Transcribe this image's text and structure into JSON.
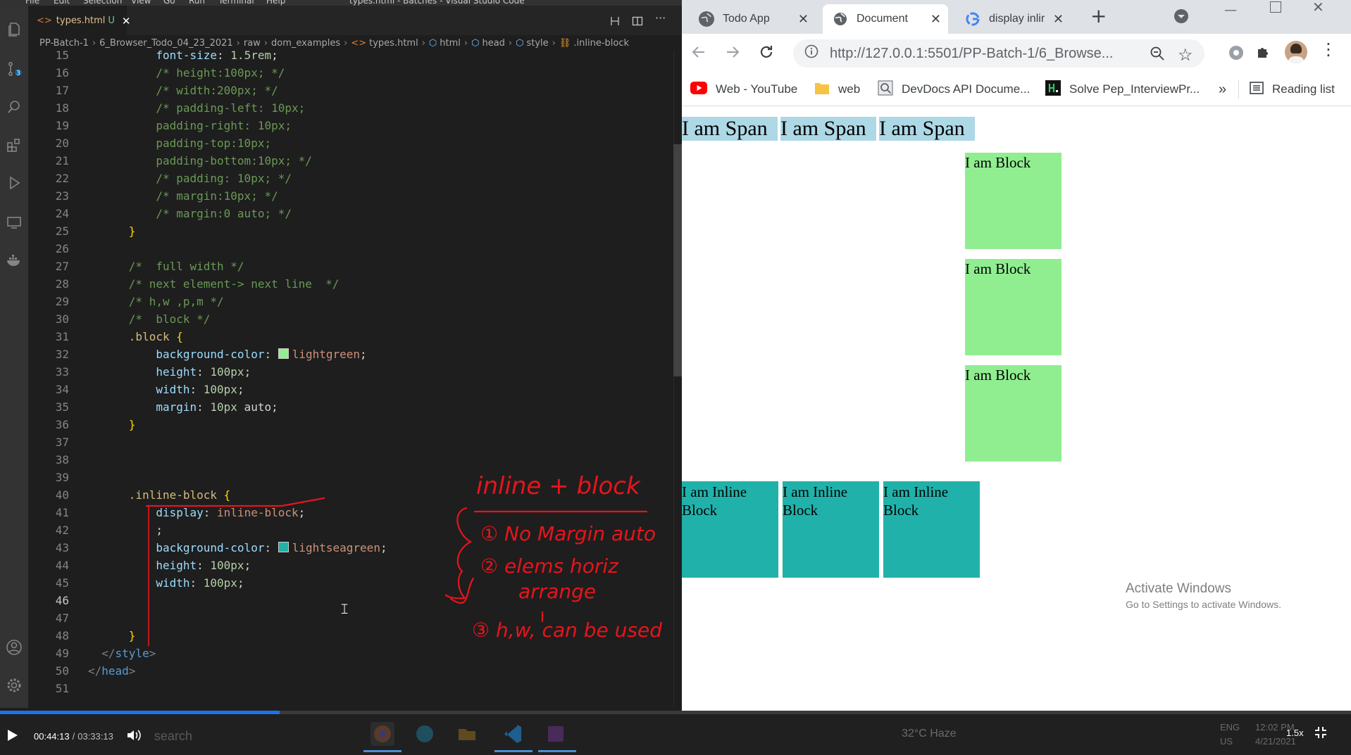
{
  "vscode": {
    "menu": [
      "File",
      "Edit",
      "Selection",
      "View",
      "Go",
      "Run",
      "Terminal",
      "Help"
    ],
    "window_title": "types.html - Batches - Visual Studio Code",
    "tab": {
      "filename": "types.html",
      "status": "U"
    },
    "breadcrumb": [
      "PP-Batch-1",
      "6_Browser_Todo_04_23_2021",
      "raw",
      "dom_examples",
      "types.html",
      "html",
      "head",
      "style",
      ".inline-block"
    ],
    "lines": [
      {
        "n": "15",
        "t": "          font-size: 1.5rem;"
      },
      {
        "n": "16",
        "t": "          /* height:100px; */"
      },
      {
        "n": "17",
        "t": "          /* width:200px; */"
      },
      {
        "n": "18",
        "t": "          /* padding-left: 10px;"
      },
      {
        "n": "19",
        "t": "          padding-right: 10px;"
      },
      {
        "n": "20",
        "t": "          padding-top:10px;"
      },
      {
        "n": "21",
        "t": "          padding-bottom:10px; */"
      },
      {
        "n": "22",
        "t": "          /* padding: 10px; */"
      },
      {
        "n": "23",
        "t": "          /* margin:10px; */"
      },
      {
        "n": "24",
        "t": "          /* margin:0 auto; */"
      },
      {
        "n": "25",
        "t": "      }"
      },
      {
        "n": "26",
        "t": ""
      },
      {
        "n": "27",
        "t": "      /*  full width */"
      },
      {
        "n": "28",
        "t": "      /* next element-> next line  */"
      },
      {
        "n": "29",
        "t": "      /* h,w ,p,m */"
      },
      {
        "n": "30",
        "t": "      /*  block */"
      },
      {
        "n": "31",
        "t": "      .block {"
      },
      {
        "n": "32",
        "t": "          background-color: lightgreen;"
      },
      {
        "n": "33",
        "t": "          height: 100px;"
      },
      {
        "n": "34",
        "t": "          width: 100px;"
      },
      {
        "n": "35",
        "t": "          margin: 10px auto;"
      },
      {
        "n": "36",
        "t": "      }"
      },
      {
        "n": "37",
        "t": ""
      },
      {
        "n": "38",
        "t": ""
      },
      {
        "n": "39",
        "t": ""
      },
      {
        "n": "40",
        "t": "      .inline-block {"
      },
      {
        "n": "41",
        "t": "          display: inline-block;"
      },
      {
        "n": "42",
        "t": "          ;"
      },
      {
        "n": "43",
        "t": "          background-color: lightseagreen;"
      },
      {
        "n": "44",
        "t": "          height: 100px;"
      },
      {
        "n": "45",
        "t": "          width: 100px;"
      },
      {
        "n": "46",
        "t": ""
      },
      {
        "n": "47",
        "t": ""
      },
      {
        "n": "48",
        "t": "      }"
      },
      {
        "n": "49",
        "t": "  </style>"
      },
      {
        "n": "50",
        "t": "</head>"
      },
      {
        "n": "51",
        "t": ""
      }
    ],
    "current_line": "46",
    "swatch_colors": {
      "lightgreen": "#90ee90",
      "lightseagreen": "#20b2aa"
    }
  },
  "annotation": {
    "title": "inline + block",
    "points": [
      "① No Margin auto",
      "② elems horiz",
      "arrange",
      "③ h,w, can be used"
    ],
    "color": "#e8141b"
  },
  "chrome": {
    "tabs": [
      {
        "title": "Todo App",
        "icon": "globe-icon",
        "active": false
      },
      {
        "title": "Document",
        "icon": "globe-icon",
        "active": true
      },
      {
        "title": "display inlir",
        "icon": "google-icon",
        "active": false
      }
    ],
    "url": "http://127.0.0.1:5501/PP-Batch-1/6_Browse...",
    "bookmarks": [
      {
        "label": "Web - YouTube",
        "icon": "youtube-icon"
      },
      {
        "label": "web",
        "icon": "folder-icon"
      },
      {
        "label": "DevDocs API Docume...",
        "icon": "devdocs-icon"
      },
      {
        "label": "Solve Pep_InterviewPr...",
        "icon": "hackerrank-icon"
      }
    ],
    "overflow": "»",
    "reading_list": "Reading list",
    "page": {
      "spans": [
        "I am Span",
        "I am Span",
        "I am Span"
      ],
      "blocks": [
        "I am Block",
        "I am Block",
        "I am Block"
      ],
      "inline_blocks": [
        "I am Inline Block",
        "I am Inline Block",
        "I am Inline Block"
      ]
    },
    "watermark": {
      "title": "Activate Windows",
      "subtitle": "Go to Settings to activate Windows."
    }
  },
  "video": {
    "current_time": "00:44:13",
    "separator": "/",
    "duration": "03:33:13",
    "speed": "1.5x",
    "progress_fraction": 0.207,
    "taskbar_search": "search",
    "weather": "32°C Haze",
    "lang": "ENG",
    "region": "US",
    "clock_time": "12:02 PM",
    "clock_date": "4/21/2021"
  }
}
